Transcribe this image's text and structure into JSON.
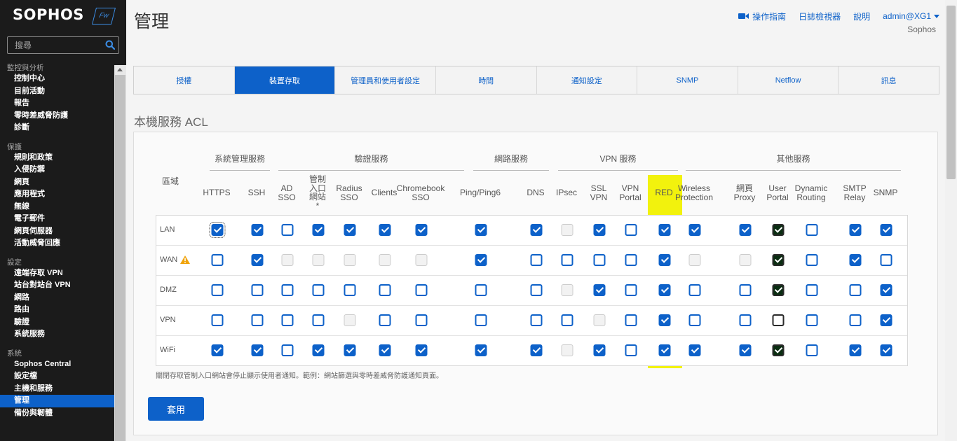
{
  "brand": {
    "name": "SOPHOS",
    "product_badge": "Fw"
  },
  "search": {
    "placeholder": "搜尋"
  },
  "sidebar": {
    "sections": [
      {
        "title": "監控與分析",
        "items": [
          "控制中心",
          "目前活動",
          "報告",
          "零時差威脅防護",
          "診斷"
        ]
      },
      {
        "title": "保護",
        "items": [
          "規則和政策",
          "入侵防禦",
          "網頁",
          "應用程式",
          "無線",
          "電子郵件",
          "網頁伺服器",
          "活動威脅回應"
        ]
      },
      {
        "title": "設定",
        "items": [
          "遠端存取 VPN",
          "站台對站台 VPN",
          "網路",
          "路由",
          "驗證",
          "系統服務"
        ]
      },
      {
        "title": "系統",
        "items": [
          "Sophos Central",
          "設定檔",
          "主機和服務",
          "管理",
          "備份與韌體"
        ]
      }
    ],
    "active_item": "管理"
  },
  "header": {
    "title": "管理",
    "links": {
      "guide": "操作指南",
      "log_viewer": "日誌檢視器",
      "help": "說明",
      "user": "admin@XG1"
    },
    "company": "Sophos"
  },
  "tabs": [
    "授權",
    "裝置存取",
    "管理員和使用者設定",
    "時間",
    "通知設定",
    "SNMP",
    "Netflow",
    "訊息"
  ],
  "active_tab": "裝置存取",
  "acl": {
    "title": "本機服務 ACL",
    "zone_header": "區域",
    "groups": [
      {
        "name": "系統管理服務",
        "columns": [
          [
            "HTTPS"
          ],
          [
            "SSH"
          ]
        ]
      },
      {
        "name": "驗證服務",
        "columns": [
          [
            "AD",
            "SSO"
          ],
          [
            "管制",
            "入口",
            "網站",
            "*"
          ],
          [
            "Radius",
            "SSO"
          ],
          [
            "Clients"
          ],
          [
            "Chromebook",
            "SSO"
          ]
        ]
      },
      {
        "name": "網路服務",
        "columns": [
          [
            "Ping/Ping6"
          ],
          [
            "DNS"
          ]
        ]
      },
      {
        "name": "VPN 服務",
        "columns": [
          [
            "IPsec"
          ],
          [
            "SSL",
            "VPN"
          ],
          [
            "VPN",
            "Portal"
          ],
          [
            "RED"
          ]
        ]
      },
      {
        "name": "其他服務",
        "columns": [
          [
            "Wireless",
            "Protection"
          ],
          [
            "網頁",
            "Proxy"
          ],
          [
            "User",
            "Portal"
          ],
          [
            "Dynamic",
            "Routing"
          ],
          [
            "SMTP",
            "Relay"
          ],
          [
            "SNMP"
          ]
        ]
      }
    ],
    "highlight_column": "RED",
    "highlight_color": "#f2f20d",
    "rows": [
      {
        "zone": "LAN",
        "warning": false,
        "states": [
          "on",
          "on",
          "off",
          "on",
          "on",
          "on",
          "on",
          "on",
          "on",
          "dis",
          "on",
          "off",
          "on",
          "on",
          "on",
          "on",
          "off",
          "on",
          "on"
        ]
      },
      {
        "zone": "WAN",
        "warning": true,
        "states": [
          "off",
          "on",
          "dis",
          "dis",
          "dis",
          "dis",
          "dis",
          "on",
          "off",
          "off",
          "off",
          "off",
          "on",
          "dis",
          "dis",
          "on",
          "off",
          "on",
          "off"
        ]
      },
      {
        "zone": "DMZ",
        "warning": false,
        "states": [
          "off",
          "off",
          "off",
          "off",
          "off",
          "off",
          "off",
          "off",
          "off",
          "dis",
          "on",
          "off",
          "on",
          "off",
          "off",
          "on",
          "off",
          "off",
          "on"
        ]
      },
      {
        "zone": "VPN",
        "warning": false,
        "states": [
          "off",
          "off",
          "off",
          "off",
          "dis",
          "off",
          "off",
          "off",
          "off",
          "off",
          "dis",
          "off",
          "on",
          "off",
          "off",
          "off",
          "off",
          "off",
          "on"
        ]
      },
      {
        "zone": "WiFi",
        "warning": false,
        "states": [
          "on",
          "on",
          "off",
          "on",
          "on",
          "on",
          "on",
          "on",
          "on",
          "dis",
          "on",
          "off",
          "on",
          "on",
          "on",
          "on",
          "off",
          "on",
          "on"
        ]
      }
    ],
    "note": "關閉存取管制入口網站會停止顯示使用者通知。範例：網站篩選與零時差威脅防護通知頁面。",
    "apply_label": "套用"
  },
  "colors": {
    "accent": "#0d61c9",
    "sidebar_bg": "#1b1b1b",
    "warning": "#f0a30a"
  }
}
